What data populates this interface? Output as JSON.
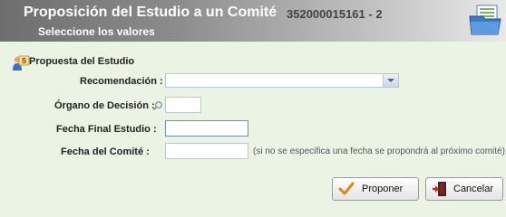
{
  "header": {
    "title": "Proposición del Estudio a un Comité",
    "code": "352000015161 - 2",
    "subtitle": "Seleccione los valores"
  },
  "section": {
    "title": "Propuesta del Estudio"
  },
  "form": {
    "recomendacion_label": "Recomendación :",
    "recomendacion_value": "",
    "organo_label": "Órgano de Decisión :",
    "organo_value": "",
    "fecha_final_label": "Fecha Final Estudio :",
    "fecha_final_value": "",
    "fecha_comite_label": "Fecha del Comité :",
    "fecha_comite_value": "",
    "fecha_comite_note": "(si no se especifica una fecha se propondrá al próximo comité)"
  },
  "buttons": {
    "proponer": "Proponer",
    "cancelar": "Cancelar"
  },
  "icons": {
    "header": "folder-documents-icon",
    "section": "users-sign-icon",
    "dropdown": "chevron-down-icon",
    "lookup": "magnifier-icon",
    "proponer": "checkmark-icon",
    "cancelar": "exit-door-icon"
  },
  "colors": {
    "background": "#eaf3e4",
    "header_start": "#6e6e6e",
    "header_end": "#e9e9e9"
  }
}
